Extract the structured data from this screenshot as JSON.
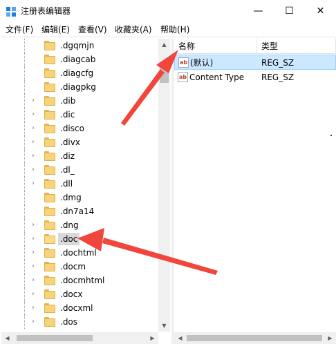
{
  "window": {
    "title": "注册表编辑器",
    "controls": {
      "minimize": "—",
      "maximize": "☐",
      "close": "✕"
    }
  },
  "menu": [
    {
      "label": "文件(F)"
    },
    {
      "label": "编辑(E)"
    },
    {
      "label": "查看(V)"
    },
    {
      "label": "收藏夹(A)"
    },
    {
      "label": "帮助(H)"
    }
  ],
  "tree": {
    "items": [
      {
        "label": ".dgqmjn",
        "expandable": false,
        "selected": false
      },
      {
        "label": ".diagcab",
        "expandable": false,
        "selected": false
      },
      {
        "label": ".diagcfg",
        "expandable": false,
        "selected": false
      },
      {
        "label": ".diagpkg",
        "expandable": false,
        "selected": false
      },
      {
        "label": ".dib",
        "expandable": true,
        "selected": false
      },
      {
        "label": ".dic",
        "expandable": true,
        "selected": false
      },
      {
        "label": ".disco",
        "expandable": true,
        "selected": false
      },
      {
        "label": ".divx",
        "expandable": true,
        "selected": false
      },
      {
        "label": ".diz",
        "expandable": true,
        "selected": false
      },
      {
        "label": ".dl_",
        "expandable": true,
        "selected": false
      },
      {
        "label": ".dll",
        "expandable": true,
        "selected": false
      },
      {
        "label": ".dmg",
        "expandable": false,
        "selected": false
      },
      {
        "label": ".dn7a14",
        "expandable": false,
        "selected": false
      },
      {
        "label": ".dng",
        "expandable": true,
        "selected": false
      },
      {
        "label": ".doc",
        "expandable": true,
        "selected": true
      },
      {
        "label": ".dochtml",
        "expandable": true,
        "selected": false
      },
      {
        "label": ".docm",
        "expandable": true,
        "selected": false
      },
      {
        "label": ".docmhtml",
        "expandable": true,
        "selected": false
      },
      {
        "label": ".docx",
        "expandable": true,
        "selected": false
      },
      {
        "label": ".docxml",
        "expandable": true,
        "selected": false
      },
      {
        "label": ".dos",
        "expandable": true,
        "selected": false
      }
    ]
  },
  "values": {
    "columns": [
      "名称",
      "类型"
    ],
    "rows": [
      {
        "icon": "ab",
        "name": "(默认)",
        "type": "REG_SZ",
        "selected": true
      },
      {
        "icon": "ab",
        "name": "Content Type",
        "type": "REG_SZ",
        "selected": false
      }
    ]
  },
  "colors": {
    "selection": "#cce8ff",
    "tree_selection": "#d9d9d9",
    "annotation_arrow": "#f0463c",
    "folder": "#f6d57a"
  }
}
